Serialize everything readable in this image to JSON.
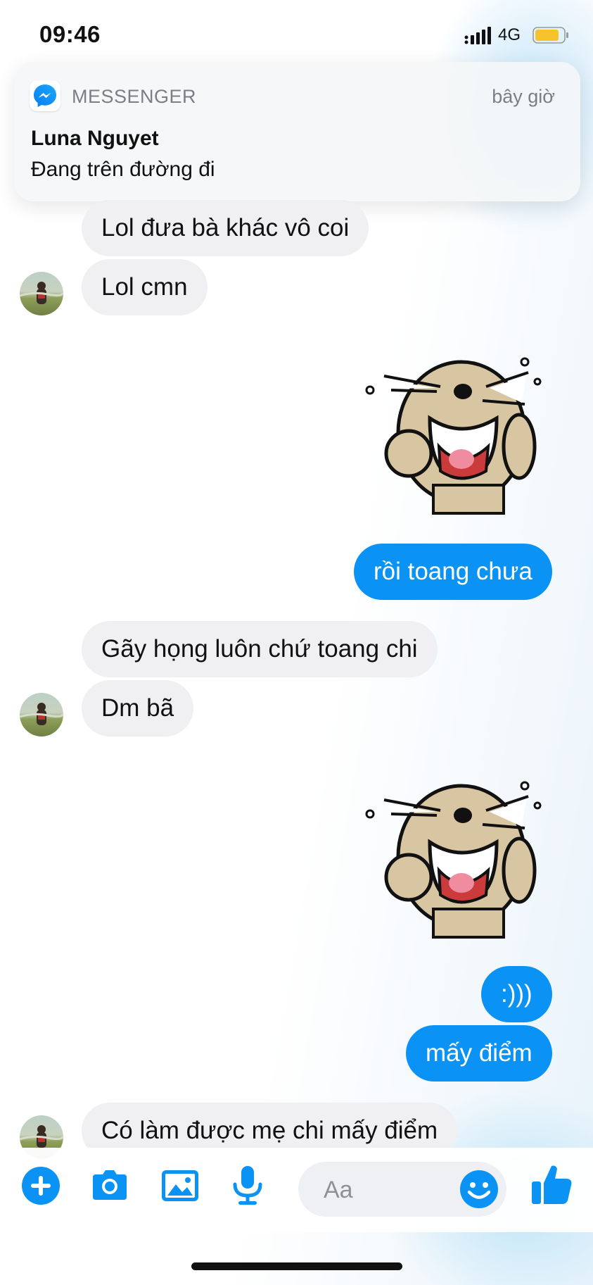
{
  "status_bar": {
    "time": "09:46",
    "network": "4G",
    "battery_color": "#f6c32b"
  },
  "notification": {
    "app_name": "MESSENGER",
    "time": "bây giờ",
    "sender": "Luna Nguyet",
    "message": "Đang trên đường đi",
    "icon": "messenger-icon"
  },
  "messages": [
    {
      "side": "in",
      "text": "Lol đưa bà khác vô coi"
    },
    {
      "side": "in",
      "text": "Lol cmn"
    },
    {
      "side": "out",
      "type": "sticker",
      "sticker": "laughing-dog-sticker"
    },
    {
      "side": "out",
      "text": "rồi toang chưa"
    },
    {
      "side": "in",
      "text": "Gãy họng luôn chứ toang chi"
    },
    {
      "side": "in",
      "text": "Dm bã"
    },
    {
      "side": "out",
      "type": "sticker",
      "sticker": "laughing-dog-sticker"
    },
    {
      "side": "out",
      "text": ":)))"
    },
    {
      "side": "out",
      "text": "mấy điểm"
    },
    {
      "side": "in",
      "text": "Có làm được mẹ chi mấy điểm"
    }
  ],
  "composer": {
    "placeholder": "Aa"
  },
  "toolbar_icons": [
    "plus-icon",
    "camera-icon",
    "image-icon",
    "microphone-icon",
    "emoji-icon",
    "thumbs-up-icon"
  ],
  "colors": {
    "accent": "#0a93f5",
    "incoming_bubble": "#f0f0f2"
  }
}
